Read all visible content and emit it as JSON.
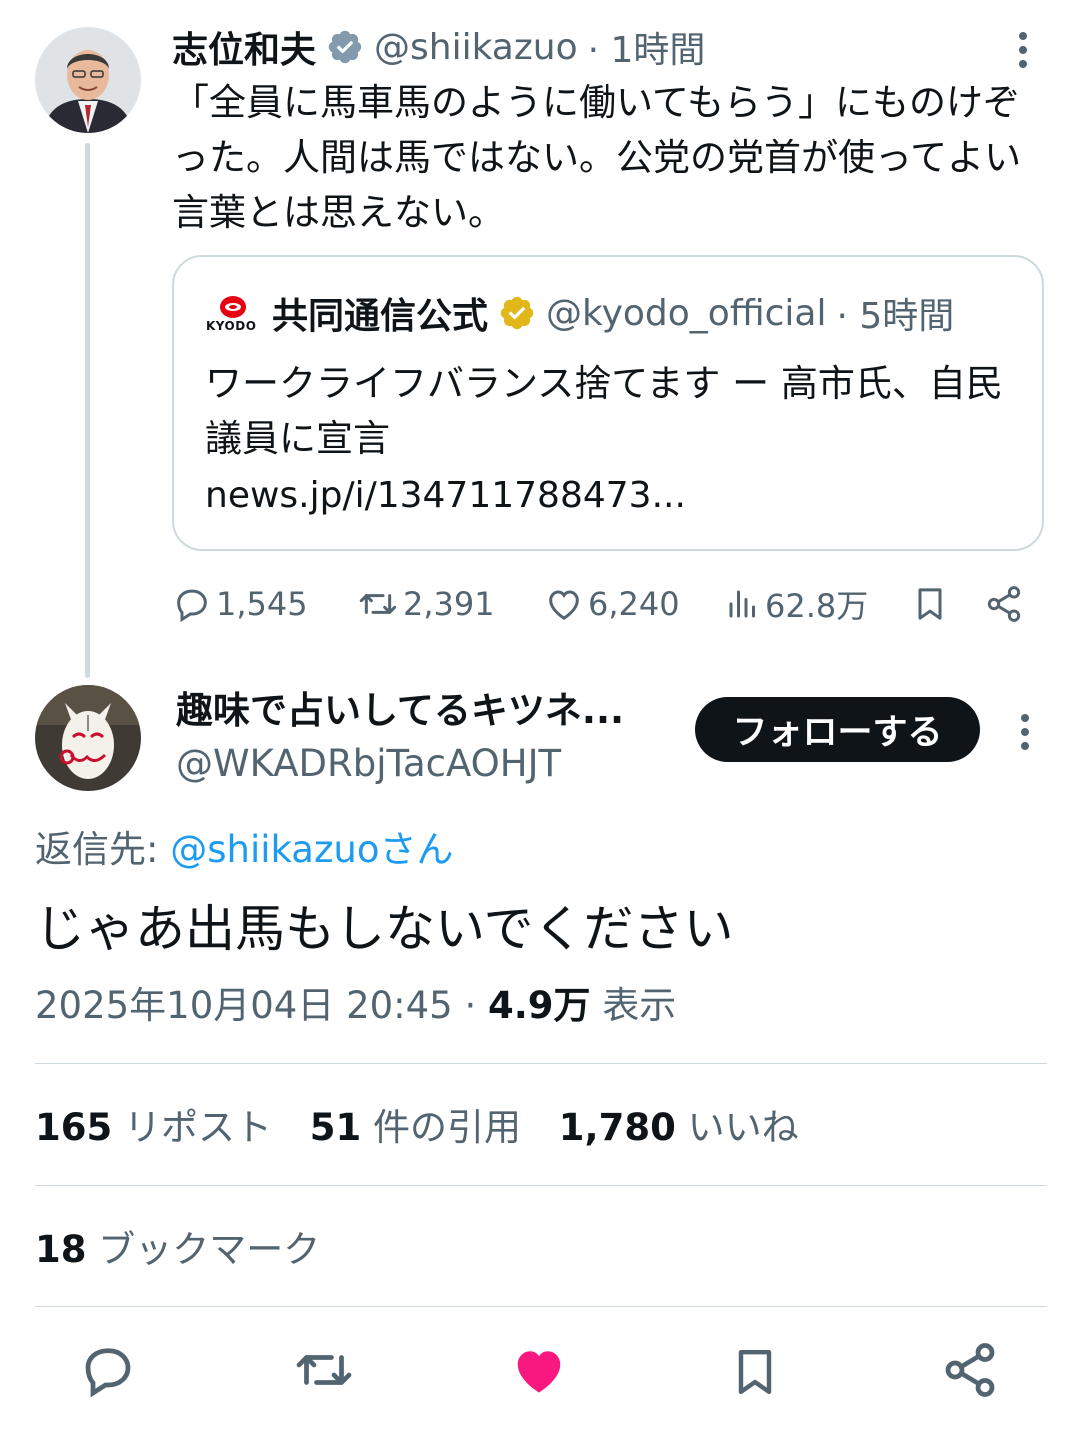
{
  "parent": {
    "author_name": "志位和夫",
    "handle": "@shiikazuo",
    "time": "· 1時間",
    "text": "「全員に馬車馬のように働いてもらう」にものけぞった。人間は馬ではない。公党の党首が使ってよい言葉とは思えない。",
    "quote": {
      "logo_text": "KYODO",
      "author_name": "共同通信公式",
      "handle": "@kyodo_official",
      "time": "· 5時間",
      "text": "ワークライフバランス捨てます ー 高市氏、自民議員に宣言",
      "link": "news.jp/i/134711788473..."
    },
    "actions": {
      "replies": "1,545",
      "reposts": "2,391",
      "likes": "6,240",
      "views": "62.8万"
    }
  },
  "reply": {
    "author_name": "趣味で占いしてるキツネ...",
    "handle": "@WKADRbjTacAOHJT",
    "follow_label": "フォローする",
    "replying_prefix": "返信先: ",
    "replying_to": "@shiikazuoさん",
    "text": "じゃあ出馬もしないでください",
    "timestamp": "2025年10月04日 20:45 · ",
    "views_count": "4.9万",
    "views_label": "表示",
    "stats": {
      "reposts_count": "165",
      "reposts_label": "リポスト",
      "quotes_count": "51",
      "quotes_label": "件の引用",
      "likes_count": "1,780",
      "likes_label": "いいね",
      "bookmarks_count": "18",
      "bookmarks_label": "ブックマーク"
    }
  },
  "colors": {
    "text": "#0f1419",
    "muted": "#536471",
    "link": "#1d9bf0",
    "border": "#cfd9de",
    "liked": "#f91880",
    "verified_grey": "#829aab",
    "verified_gold": "#e2b719"
  },
  "icons": [
    "more-icon",
    "verified-grey-icon",
    "verified-gold-icon",
    "reply-icon",
    "repost-icon",
    "like-icon",
    "views-icon",
    "bookmark-icon",
    "share-icon"
  ]
}
